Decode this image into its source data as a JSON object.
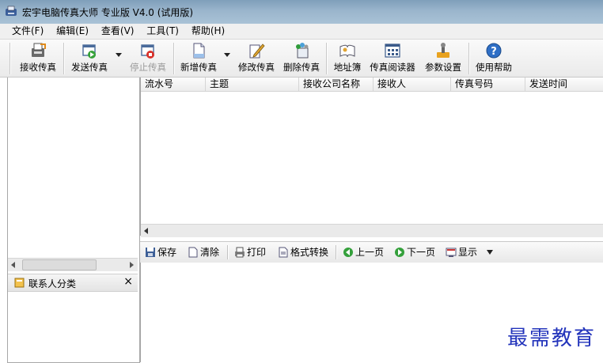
{
  "window": {
    "title": "宏宇电脑传真大师 专业版 V4.0 (试用版)"
  },
  "menu": [
    "文件(F)",
    "编辑(E)",
    "查看(V)",
    "工具(T)",
    "帮助(H)"
  ],
  "toolbar": {
    "receive": "接收传真",
    "send": "发送传真",
    "stop": "停止传真",
    "new": "新增传真",
    "edit": "修改传真",
    "delete": "删除传真",
    "address_book": "地址簿",
    "reader": "传真阅读器",
    "settings": "参数设置",
    "help": "使用帮助"
  },
  "grid": {
    "columns": [
      "流水号",
      "主题",
      "接收公司名称",
      "接收人",
      "传真号码",
      "发送时间"
    ]
  },
  "left": {
    "contact_category": "联系人分类",
    "close": "×"
  },
  "preview_toolbar": {
    "save": "保存",
    "clear": "清除",
    "print": "打印",
    "convert": "格式转换",
    "prev": "上一页",
    "next": "下一页",
    "display": "显示"
  },
  "watermark": "最需教育",
  "icons": {
    "app": "fax-app-icon",
    "receive": "receive-fax-icon",
    "send": "send-fax-icon",
    "stop": "stop-fax-icon",
    "new": "new-document-icon",
    "edit": "edit-document-icon",
    "delete": "delete-fax-icon",
    "address_book": "address-book-icon",
    "reader": "fax-reader-icon",
    "settings": "settings-icon",
    "help": "help-icon"
  }
}
